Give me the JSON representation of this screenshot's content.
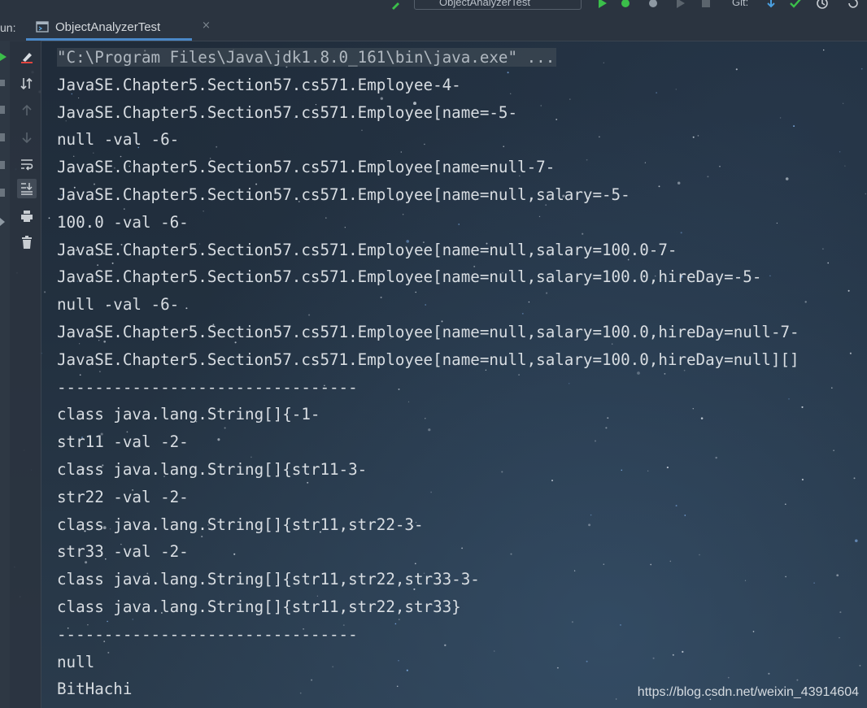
{
  "toolbar": {
    "run_config": "ObjectAnalyzerTest",
    "git_label": "Git:"
  },
  "run_panel": {
    "label": "Run:",
    "label_visible": "un:",
    "tab_label": "ObjectAnalyzerTest",
    "tab_close": "×"
  },
  "console": {
    "command_line": "\"C:\\Program Files\\Java\\jdk1.8.0_161\\bin\\java.exe\" ...",
    "lines": [
      "JavaSE.Chapter5.Section57.cs571.Employee-4-",
      "JavaSE.Chapter5.Section57.cs571.Employee[name=-5-",
      "null -val -6-",
      "JavaSE.Chapter5.Section57.cs571.Employee[name=null-7-",
      "JavaSE.Chapter5.Section57.cs571.Employee[name=null,salary=-5-",
      "100.0 -val -6-",
      "JavaSE.Chapter5.Section57.cs571.Employee[name=null,salary=100.0-7-",
      "JavaSE.Chapter5.Section57.cs571.Employee[name=null,salary=100.0,hireDay=-5-",
      "null -val -6-",
      "JavaSE.Chapter5.Section57.cs571.Employee[name=null,salary=100.0,hireDay=null-7-",
      "JavaSE.Chapter5.Section57.cs571.Employee[name=null,salary=100.0,hireDay=null][]",
      "--------------------------------",
      "class java.lang.String[]{-1-",
      "str11 -val -2-",
      "class java.lang.String[]{str11-3-",
      "str22 -val -2-",
      "class java.lang.String[]{str11,str22-3-",
      "str33 -val -2-",
      "class java.lang.String[]{str11,str22,str33-3-",
      "class java.lang.String[]{str11,str22,str33}",
      "--------------------------------",
      "null",
      "BitHachi"
    ]
  },
  "gutter_icons": [
    "clear-console-icon",
    "sort-icon",
    "up-arrow-icon",
    "down-arrow-icon",
    "soft-wrap-icon",
    "scroll-to-end-icon",
    "print-icon",
    "trash-icon"
  ],
  "watermark": "https://blog.csdn.net/weixin_43914604",
  "colors": {
    "console_text": "#d8dde2",
    "background": "#22303f",
    "toolbar": "#2b3440",
    "accent": "#4a88c7",
    "run_green": "#3bbf4a"
  }
}
